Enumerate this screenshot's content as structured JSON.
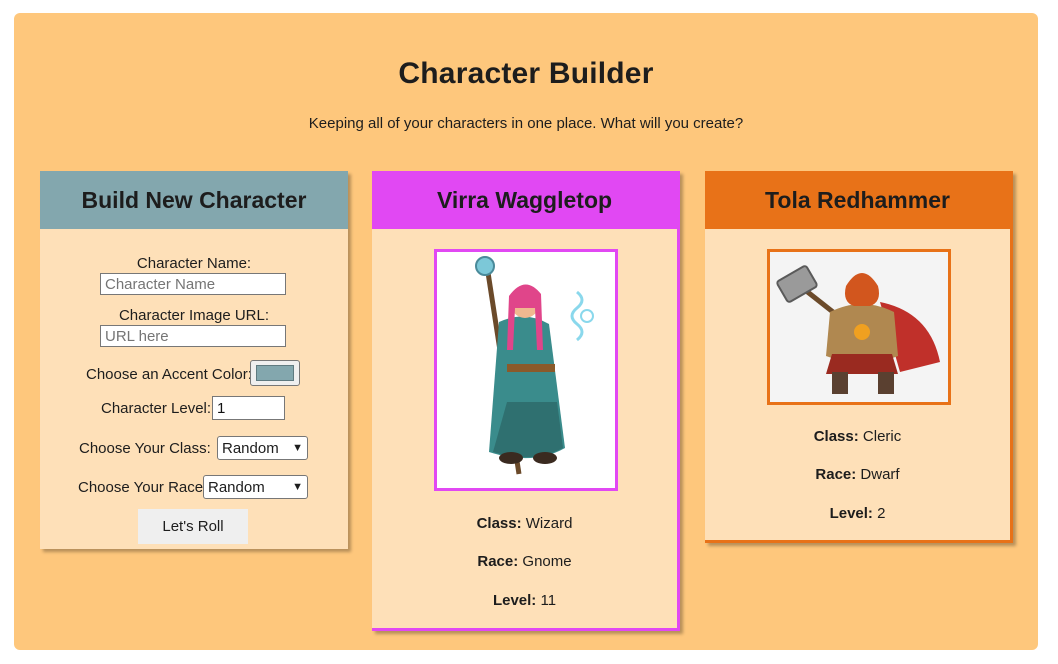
{
  "header": {
    "title": "Character Builder",
    "subtitle": "Keeping all of your characters in one place. What will you create?"
  },
  "builder": {
    "heading": "Build New Character",
    "name_label": "Character Name:",
    "name_placeholder": "Character Name",
    "image_label": "Character Image URL:",
    "image_placeholder": "URL here",
    "color_label": "Choose an Accent Color:",
    "color_value": "#83a7ae",
    "level_label": "Character Level:",
    "level_value": "1",
    "class_label": "Choose Your Class:",
    "class_value": "Random",
    "race_label": "Choose Your Race:",
    "race_value": "Random",
    "button_label": "Let's Roll"
  },
  "characters": [
    {
      "name": "Virra Waggletop",
      "accent": "#e148f3",
      "class_label": "Class:",
      "class_value": "Wizard",
      "race_label": "Race:",
      "race_value": "Gnome",
      "level_label": "Level:",
      "level_value": "11",
      "portrait_icon": "wizard-gnome-portrait"
    },
    {
      "name": "Tola Redhammer",
      "accent": "#e87218",
      "class_label": "Class:",
      "class_value": "Cleric",
      "race_label": "Race:",
      "race_value": "Dwarf",
      "level_label": "Level:",
      "level_value": "2",
      "portrait_icon": "cleric-dwarf-portrait"
    }
  ],
  "colors": {
    "page_bg": "#fec77c",
    "card_bg": "#fee0b8",
    "builder_accent": "#83a7ae"
  }
}
